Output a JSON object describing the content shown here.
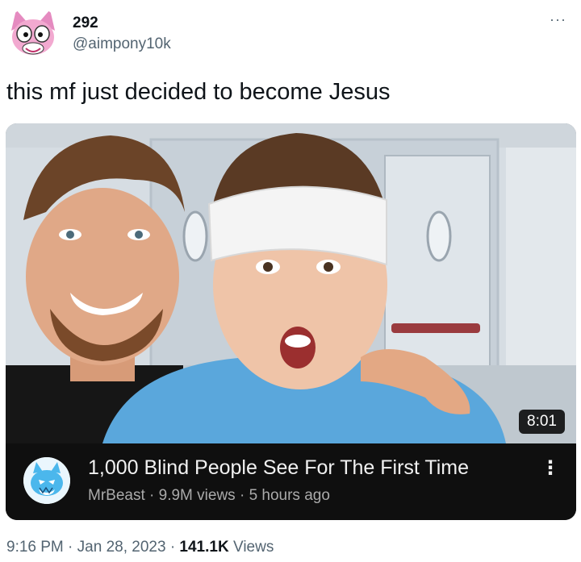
{
  "author": {
    "display_name": "292",
    "handle": "@aimpony10k",
    "avatar_icon": "pink-cartoon-fox-avatar"
  },
  "more_icon": "···",
  "tweet": {
    "text": "this mf just decided to become Jesus"
  },
  "video": {
    "duration": "8:01",
    "title": "1,000 Blind People See For The First Time",
    "channel": "MrBeast",
    "sep1": "·",
    "views": "9.9M views",
    "sep2": "·",
    "age": "5 hours ago",
    "menu_icon": "⋮",
    "channel_icon": "mrbeast-panther-logo"
  },
  "footer": {
    "time": "9:16 PM",
    "sep1": "·",
    "date": "Jan 28, 2023",
    "sep2": "·",
    "views_count": "141.1K",
    "views_label": "Views"
  },
  "colors": {
    "text_primary": "#0f1419",
    "text_secondary": "#536471",
    "video_bar_bg": "#0f0f0f",
    "video_meta": "#aaaaaa",
    "gown_blue": "#5aa7dc"
  }
}
